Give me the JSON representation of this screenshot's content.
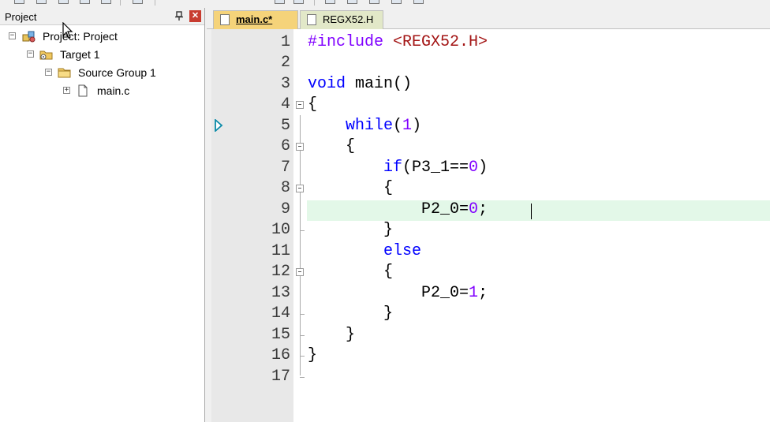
{
  "project_panel": {
    "title": "Project",
    "tree": [
      {
        "label": "Project: Project",
        "icon": "project-icon"
      },
      {
        "label": "Target 1",
        "icon": "target-folder-icon"
      },
      {
        "label": "Source Group 1",
        "icon": "folder-icon"
      },
      {
        "label": "main.c",
        "icon": "file-icon"
      }
    ]
  },
  "tabs": [
    {
      "label": "main.c*",
      "active": true
    },
    {
      "label": "REGX52.H",
      "active": false
    }
  ],
  "editor": {
    "line_numbers": [
      "1",
      "2",
      "3",
      "4",
      "5",
      "6",
      "7",
      "8",
      "9",
      "10",
      "11",
      "12",
      "13",
      "14",
      "15",
      "16",
      "17"
    ],
    "current_line": 9,
    "code": {
      "l1_include": "#include",
      "l1_header": " <REGX52.H>",
      "l3_void": "void",
      "l3_rest": " main()",
      "l4": "{",
      "l5_while": "while",
      "l5_open": "(",
      "l5_num": "1",
      "l5_close": ")",
      "l6": "{",
      "l7_if": "if",
      "l7_mid": "(P3_1==",
      "l7_num": "0",
      "l7_close": ")",
      "l8": "{",
      "l9_a": "P2_0=",
      "l9_num": "0",
      "l9_b": ";",
      "l10": "}",
      "l11_else": "else",
      "l12": "{",
      "l13_a": "P2_0=",
      "l13_num": "1",
      "l13_b": ";",
      "l14": "}",
      "l15": "}",
      "l16": "}"
    }
  },
  "colors": {
    "keyword": "#0000ff",
    "number": "#8000ff",
    "header": "#a31515",
    "active_tab": "#f5d37a",
    "line_highlight": "#e3f8e8"
  }
}
